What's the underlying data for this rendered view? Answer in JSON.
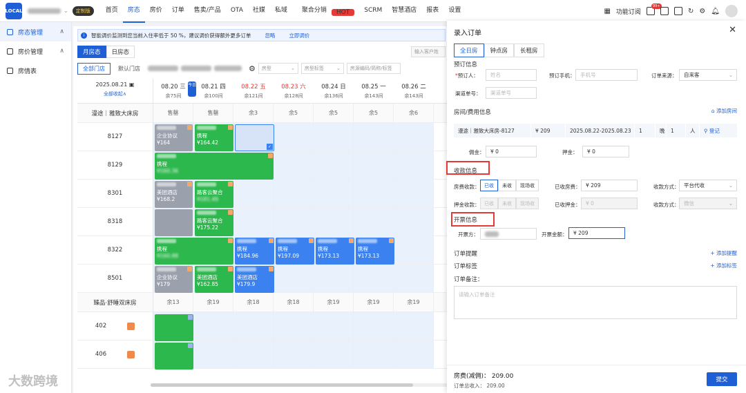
{
  "topbar": {
    "logo_text": "LOCAL",
    "edition_badge": "定制版",
    "nav": [
      {
        "label": "首页"
      },
      {
        "label": "房态",
        "active": true
      },
      {
        "label": "房价"
      },
      {
        "label": "订单"
      },
      {
        "label": "售卖/产品"
      },
      {
        "label": "OTA"
      },
      {
        "label": "社媒"
      },
      {
        "label": "私域"
      },
      {
        "label": "聚合分销",
        "hot": "HOT"
      },
      {
        "label": "SCRM"
      },
      {
        "label": "智慧酒店"
      },
      {
        "label": "报表"
      },
      {
        "label": "设置"
      }
    ],
    "feature_sub": "功能订阅",
    "msg_badge": "99+"
  },
  "sidebar": {
    "items": [
      {
        "label": "房态管理",
        "active": true
      },
      {
        "label": "房价管理"
      },
      {
        "label": "房情表"
      }
    ]
  },
  "notice": {
    "text": "智能调价监测到您当前入住率低于 50 %，建议调价获得额外更多订单",
    "ignore": "忽略",
    "adjust": "立即调价"
  },
  "view_tabs": [
    "月房态",
    "日房态"
  ],
  "search_placeholder": "输入客户姓",
  "filters": {
    "all_stores": "全部门店",
    "default_store": "默认门店",
    "room_type": "房型",
    "room_tag": "房型标签",
    "search": "房源编码/简称/标签"
  },
  "grid": {
    "date": "2025.08.21",
    "collapse": "全部收起∧",
    "today": "今日",
    "days": [
      {
        "date": "08.20 三",
        "rest": "余75间"
      },
      {
        "date": "08.21 四",
        "rest": "余100间"
      },
      {
        "date": "08.22 五",
        "rest": "余121间",
        "red": true
      },
      {
        "date": "08.23 六",
        "rest": "余128间",
        "red": true
      },
      {
        "date": "08.24 日",
        "rest": "余136间"
      },
      {
        "date": "08.25 一",
        "rest": "余143间"
      },
      {
        "date": "08.26 二",
        "rest": "余143间"
      }
    ],
    "type1": {
      "name": "漫途｜雅致大床房",
      "cells": [
        "售罄",
        "售罄",
        "余3",
        "余5",
        "余5",
        "余5",
        "余6"
      ]
    },
    "rooms1": [
      "8127",
      "8129",
      "8301",
      "8318",
      "8322",
      "8501"
    ],
    "type2": {
      "name": "臻品·舒睡双床房",
      "cells": [
        "余13",
        "余19",
        "余18",
        "余18",
        "余19",
        "余19",
        "余19"
      ]
    },
    "rooms2": [
      "402",
      "406"
    ],
    "bookings": {
      "b1": {
        "channel": "企业协议",
        "price": "¥164"
      },
      "b2": {
        "channel": "携程",
        "price": "¥164.42"
      },
      "b3": {
        "channel": "携程",
        "price": "¥160.36"
      },
      "b4": {
        "channel": "美团酒店",
        "price": "¥168.2"
      },
      "b5": {
        "channel": "路客云聚合",
        "price": "¥181.49"
      },
      "b6": {
        "channel": "路客云聚合",
        "price": "¥175.22"
      },
      "b7": {
        "channel": "携程",
        "price": "¥160.88"
      },
      "b8": {
        "channel": "携程",
        "price": "¥184.96"
      },
      "b9": {
        "channel": "携程",
        "price": "¥197.09"
      },
      "b10": {
        "channel": "携程",
        "price": "¥173.13"
      },
      "b11": {
        "channel": "携程",
        "price": "¥173.13"
      },
      "b12": {
        "channel": "企业协议",
        "price": "¥179"
      },
      "b13": {
        "channel": "美团酒店",
        "price": "¥162.85"
      },
      "b14": {
        "channel": "美团酒店",
        "price": "¥179.9"
      }
    }
  },
  "watermark": "大数跨境",
  "panel": {
    "title": "录入订单",
    "tabs": [
      "全日房",
      "钟点房",
      "长租房"
    ],
    "booking_section": "预订信息",
    "booker_label": "预订人：",
    "booker_placeholder": "姓名",
    "phone_label": "预订手机：",
    "phone_placeholder": "手机号",
    "source_label": "订单来源：",
    "source_value": "自来客",
    "channel_no_label": "渠道单号：",
    "channel_no_placeholder": "渠道单号",
    "room_fee_section": "房间/费用信息",
    "add_room": "添加房间",
    "room_line": {
      "room": "漫途｜雅致大床房-8127",
      "price": "¥ 209",
      "dates": "2025.08.22-2025.08.23",
      "nights": "1",
      "nights_unit": "晚",
      "guests": "1",
      "guests_unit": "人",
      "register": "登记"
    },
    "commission_label": "佣金：",
    "commission_value": "¥  0",
    "deposit_label": "押金：",
    "deposit_value": "¥  0",
    "collect_section": "收款信息",
    "room_collect_label": "房费收款：",
    "collect_opts": [
      "已收",
      "未收",
      "现场收"
    ],
    "received_room_label": "已收房费：",
    "received_room_value": "¥  209",
    "pay_method_label": "收款方式：",
    "pay_method_value": "平台代收",
    "deposit_collect_label": "押金收款：",
    "received_deposit_label": "已收押金：",
    "received_deposit_value": "¥  0",
    "pay_method2_value": "微信",
    "invoice_section": "开票信息",
    "invoice_party_label": "开票方：",
    "invoice_amount_label": "开票金额：",
    "invoice_amount_value": "¥  209",
    "reminder": "订单提醒",
    "add_reminder": "添加提醒",
    "tag": "订单标签",
    "add_tag": "添加标签",
    "remark": "订单备注：",
    "remark_placeholder": "请输入订单备注",
    "fee_line": "房费(减佣)：  209.00",
    "total_line": "订单总收入：  209.00",
    "submit": "提交"
  },
  "colors": {
    "brand": "#1f5fd6",
    "booking_green": "#2db84d",
    "booking_blue": "#3b82f0",
    "booking_gray": "#9aa0ac",
    "highlight_red": "#e53935"
  }
}
